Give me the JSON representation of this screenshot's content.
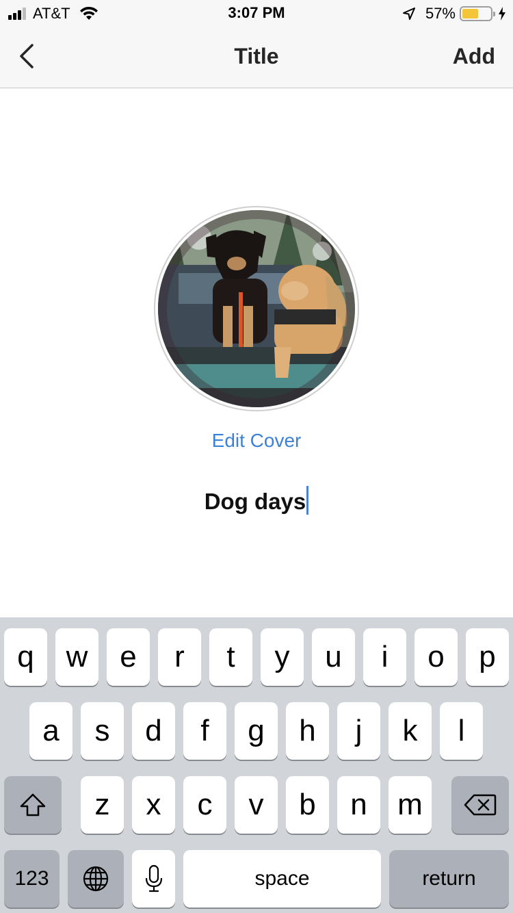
{
  "status_bar": {
    "carrier": "AT&T",
    "time": "3:07 PM",
    "battery_percent": "57%",
    "battery_level": 0.57,
    "signal_bars_filled": 3,
    "signal_bars_total": 4,
    "icons": [
      "signal-icon",
      "wifi-icon",
      "location-arrow-icon",
      "battery-icon",
      "charging-bolt-icon"
    ],
    "battery_color": "#f4c53a"
  },
  "nav": {
    "back_icon": "chevron-left-icon",
    "title": "Title",
    "add_label": "Add"
  },
  "cover": {
    "edit_label": "Edit Cover"
  },
  "title_field": {
    "value": "Dog days"
  },
  "keyboard": {
    "row1": [
      "q",
      "w",
      "e",
      "r",
      "t",
      "y",
      "u",
      "i",
      "o",
      "p"
    ],
    "row2": [
      "a",
      "s",
      "d",
      "f",
      "g",
      "h",
      "j",
      "k",
      "l"
    ],
    "row3": [
      "z",
      "x",
      "c",
      "v",
      "b",
      "n",
      "m"
    ],
    "shift_icon": "shift-arrow-icon",
    "delete_icon": "backspace-icon",
    "numbers_label": "123",
    "globe_icon": "globe-icon",
    "mic_icon": "microphone-icon",
    "space_label": "space",
    "return_label": "return"
  },
  "colors": {
    "accent_link": "#3b82d6",
    "caret": "#4c7ee0",
    "keyboard_bg": "#d1d4d9"
  }
}
